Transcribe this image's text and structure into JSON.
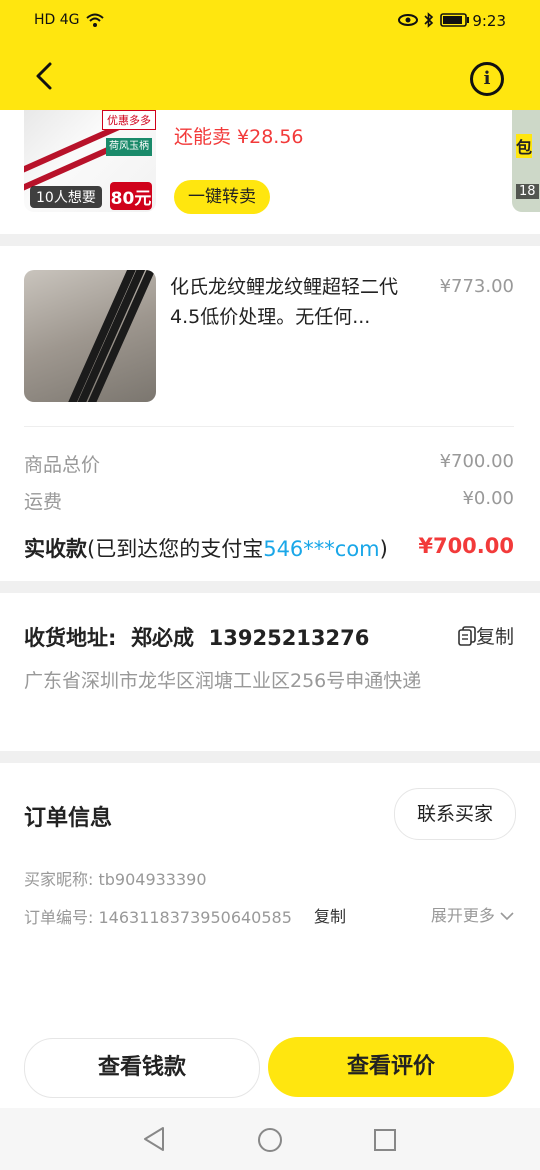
{
  "status_bar": {
    "left_icons": "HD 4G",
    "time": "9:23"
  },
  "header": {
    "back_icon": "chevron-left-icon",
    "info_icon": "info-circle-icon"
  },
  "promo": {
    "badge": "优惠多多",
    "tag": "荷风玉柄",
    "wants": "10人想要",
    "price_badge": "80元",
    "resell_price": "还能卖 ¥28.56",
    "resell_button": "一键转卖",
    "right_label": "包",
    "right_count": "18"
  },
  "product": {
    "title": "化氏龙纹鲤龙纹鲤超轻二代4.5低价处理。无任何...",
    "price": "¥773.00"
  },
  "summary": {
    "total_label": "商品总价",
    "total_value": "¥700.00",
    "shipping_label": "运费",
    "shipping_value": "¥0.00",
    "net_label": "实收款",
    "net_note_prefix": "(已到达您的支付宝",
    "net_account": "546***com",
    "net_note_suffix": ")",
    "net_value": "¥700.00"
  },
  "address": {
    "title": "收货地址:  郑必成  13925213276",
    "copy_label": "复制",
    "detail": "广东省深圳市龙华区润塘工业区256号申通快递"
  },
  "order": {
    "title": "订单信息",
    "contact_button": "联系买家",
    "buyer_nick": "买家昵称: tb904933390",
    "order_no": "订单编号: 1463118373950640585",
    "copy_label": "复制",
    "expand_label": "展开更多"
  },
  "actions": {
    "view_money": "查看钱款",
    "view_review": "查看评价"
  },
  "colors": {
    "brand_yellow": "#ffe60f",
    "price_red": "#f23a3a",
    "link_blue": "#1aa7e8"
  }
}
